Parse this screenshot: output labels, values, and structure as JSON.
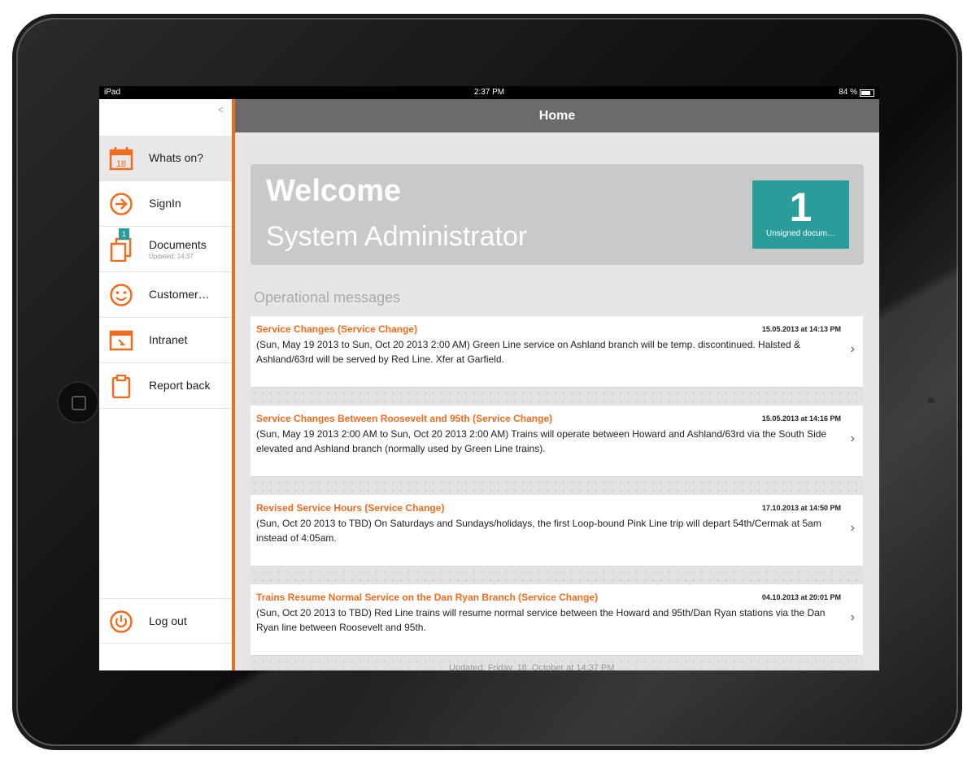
{
  "statusbar": {
    "device": "iPad",
    "time": "2:37 PM",
    "battery": "84 %"
  },
  "sidebar": {
    "collapse_glyph": "<",
    "items": [
      {
        "icon": "calendar-icon",
        "label": "Whats on?",
        "icon_text": "18"
      },
      {
        "icon": "sign-in-icon",
        "label": "SignIn"
      },
      {
        "icon": "documents-icon",
        "label": "Documents",
        "sublabel": "Updated: 14:37",
        "badge": "1"
      },
      {
        "icon": "smiley-icon",
        "label": "Customer…"
      },
      {
        "icon": "browser-icon",
        "label": "Intranet"
      },
      {
        "icon": "clipboard-icon",
        "label": "Report back"
      }
    ],
    "logout": {
      "icon": "power-icon",
      "label": "Log out"
    }
  },
  "header": {
    "title": "Home"
  },
  "welcome": {
    "title": "Welcome",
    "name": "System Administrator",
    "tile_count": "1",
    "tile_label": "Unsigned docum…"
  },
  "section_title": "Operational messages",
  "messages": [
    {
      "title": "Service Changes (Service Change)",
      "date": "15.05.2013 at 14:13 PM",
      "body": "(Sun, May 19 2013  to Sun, Oct 20 2013 2:00 AM) Green Line service on Ashland branch will be temp. discontinued. Halsted & Ashland/63rd will be served by Red Line. Xfer at Garfield."
    },
    {
      "title": "Service Changes Between Roosevelt and 95th (Service Change)",
      "date": "15.05.2013 at 14:16 PM",
      "body": "(Sun, May 19 2013  2:00 AM to Sun, Oct 20 2013 2:00 AM) Trains will operate between Howard and Ashland/63rd via the South Side elevated and Ashland branch (normally used by Green Line trains)."
    },
    {
      "title": "Revised Service Hours (Service Change)",
      "date": "17.10.2013 at 14:50 PM",
      "body": "(Sun, Oct 20 2013 to TBD) On Saturdays and Sundays/holidays, the first Loop-bound Pink Line trip will depart 54th/Cermak at 5am instead of 4:05am."
    },
    {
      "title": "Trains Resume Normal Service on the Dan Ryan Branch (Service Change)",
      "date": "04.10.2013 at 20:01 PM",
      "body": "(Sun, Oct 20 2013 to TBD) Red Line trains will resume normal service between the Howard and 95th/Dan Ryan stations via the Dan Ryan line between Roosevelt and 95th."
    }
  ],
  "footer_note": "Updated: Friday, 18. October at 14:37 PM",
  "colors": {
    "accent": "#f26b1d",
    "teal": "#2a9d9a",
    "header": "#6b6b6b"
  }
}
